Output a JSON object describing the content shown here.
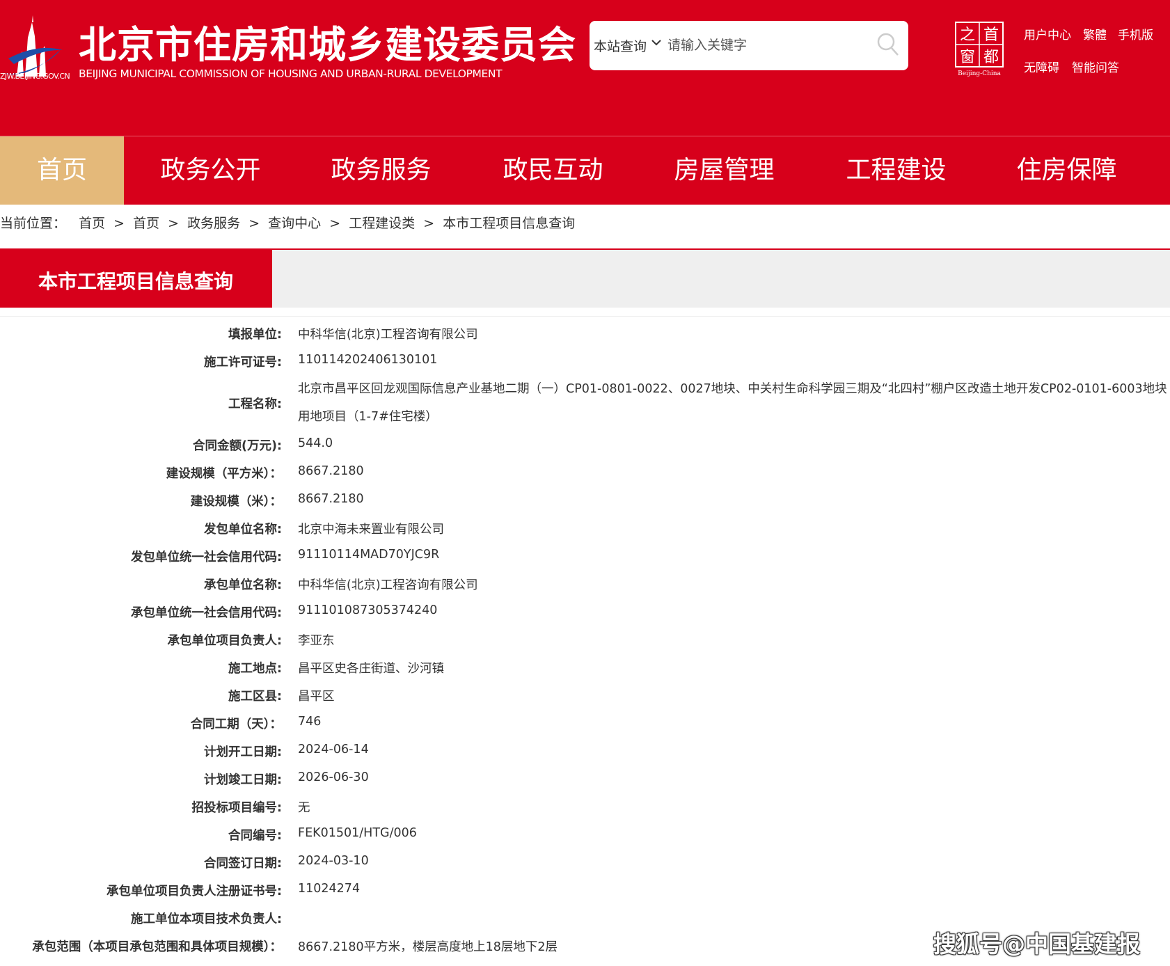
{
  "header": {
    "logo_url_text": "ZJW.BEIJING.GOV.CN",
    "title": "北京市住房和城乡建设委员会",
    "subtitle": "BEIJING MUNICIPAL COMMISSION OF HOUSING AND URBAN-RURAL DEVELOPMENT",
    "capital_logo_text": [
      "之",
      "首",
      "窗",
      "都"
    ],
    "capital_logo_caption": "Beijing-China",
    "links": [
      "用户中心",
      "繁體",
      "手机版",
      "无障碍",
      "智能问答"
    ]
  },
  "search": {
    "scope_label": "本站查询",
    "placeholder": "请输入关键字"
  },
  "nav": {
    "items": [
      "首页",
      "政务公开",
      "政务服务",
      "政民互动",
      "房屋管理",
      "工程建设",
      "住房保障"
    ],
    "active_index": 0
  },
  "breadcrumb": {
    "prefix": "当前位置：",
    "items": [
      "首页",
      "首页",
      "政务服务",
      "查询中心",
      "工程建设类",
      "本市工程项目信息查询"
    ],
    "separator": ">"
  },
  "section": {
    "title": "本市工程项目信息查询"
  },
  "details": [
    {
      "label": "填报单位:",
      "value": "中科华信(北京)工程咨询有限公司"
    },
    {
      "label": "施工许可证号:",
      "value": "110114202406130101"
    },
    {
      "label": "工程名称:",
      "value": "北京市昌平区回龙观国际信息产业基地二期（一）CP01-0801-0022、0027地块、中关村生命科学园三期及“北四村”棚户区改造土地开发CP02-0101-6003地块用地项目（1-7#住宅楼）"
    },
    {
      "label": "合同金额(万元):",
      "value": "544.0"
    },
    {
      "label": "建设规模（平方米）：",
      "value": "8667.2180"
    },
    {
      "label": "建设规模（米）：",
      "value": "8667.2180"
    },
    {
      "label": "发包单位名称:",
      "value": "北京中海未来置业有限公司"
    },
    {
      "label": "发包单位统一社会信用代码:",
      "value": "91110114MAD70YJC9R"
    },
    {
      "label": "承包单位名称:",
      "value": "中科华信(北京)工程咨询有限公司"
    },
    {
      "label": "承包单位统一社会信用代码:",
      "value": "911101087305374240"
    },
    {
      "label": "承包单位项目负责人:",
      "value": "李亚东"
    },
    {
      "label": "施工地点:",
      "value": "昌平区史各庄街道、沙河镇"
    },
    {
      "label": "施工区县:",
      "value": "昌平区"
    },
    {
      "label": "合同工期（天）：",
      "value": "746"
    },
    {
      "label": "计划开工日期:",
      "value": "2024-06-14"
    },
    {
      "label": "计划竣工日期:",
      "value": "2026-06-30"
    },
    {
      "label": "招投标项目编号:",
      "value": "无"
    },
    {
      "label": "合同编号:",
      "value": "FEK01501/HTG/006"
    },
    {
      "label": "合同签订日期:",
      "value": "2024-03-10"
    },
    {
      "label": "承包单位项目负责人注册证书号:",
      "value": "11024274"
    },
    {
      "label": "施工单位本项目技术负责人:",
      "value": ""
    },
    {
      "label": "承包范围（本项目承包范围和具体项目规模）：",
      "value": "8667.2180平方米，楼层高度地上18层地下2层"
    }
  ],
  "watermark": "搜狐号@中国基建报",
  "colors": {
    "brand_red": "#d7001b",
    "active_tab": "#e4b97a",
    "section_bg": "#efefef"
  }
}
